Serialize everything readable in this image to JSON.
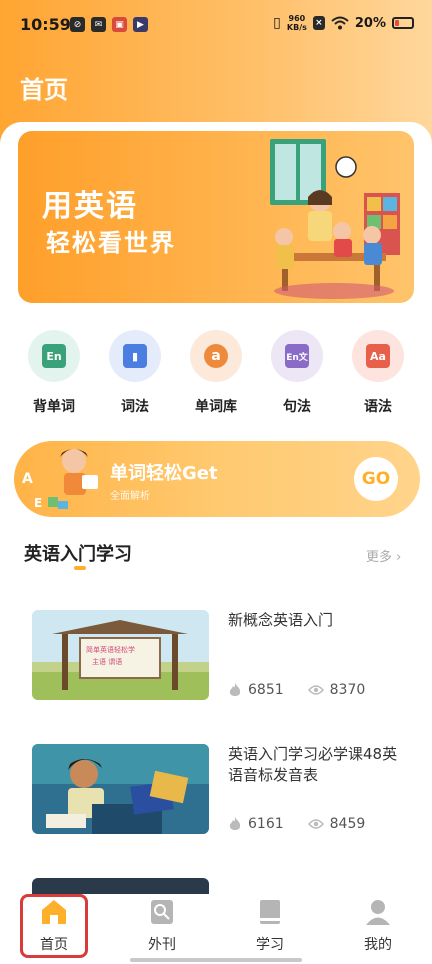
{
  "status_bar": {
    "time": "10:59",
    "speed_value": "960",
    "speed_unit": "KB/s",
    "battery": "20%"
  },
  "page_title": "首页",
  "banner": {
    "line1": "用英语",
    "line2": "轻松看世界"
  },
  "quick_actions": [
    {
      "label": "背单词",
      "icon": "en-card-icon"
    },
    {
      "label": "词法",
      "icon": "book-bookmark-icon"
    },
    {
      "label": "单词库",
      "icon": "letter-a-icon"
    },
    {
      "label": "句法",
      "icon": "en-translate-icon"
    },
    {
      "label": "语法",
      "icon": "aa-icon"
    }
  ],
  "promo": {
    "title": "单词轻松Get",
    "subtitle": "全面解析",
    "go": "GO"
  },
  "section": {
    "title": "英语入门学习",
    "more": "更多"
  },
  "courses": [
    {
      "title": "新概念英语入门",
      "likes": "6851",
      "views": "8370"
    },
    {
      "title": "英语入门学习必学课48英语音标发音表",
      "likes": "6161",
      "views": "8459"
    }
  ],
  "tabs": [
    {
      "label": "首页",
      "active": true
    },
    {
      "label": "外刊",
      "active": false
    },
    {
      "label": "学习",
      "active": false
    },
    {
      "label": "我的",
      "active": false
    }
  ],
  "colors": {
    "accent": "#ffa532",
    "highlight_outline": "#d93a3a"
  }
}
